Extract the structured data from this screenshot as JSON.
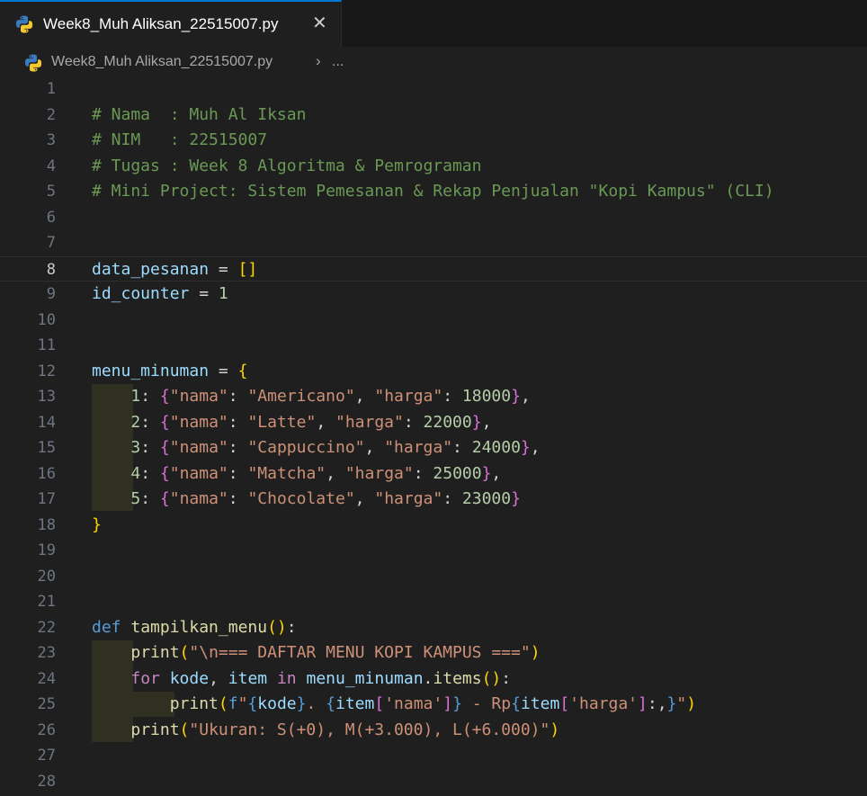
{
  "tab": {
    "title": "Week8_Muh Aliksan_22515007.py",
    "close": "✕"
  },
  "breadcrumb": {
    "file": "Week8_Muh Aliksan_22515007.py",
    "sep": "›",
    "more": "..."
  },
  "current_line": 8,
  "lines": [
    [],
    [
      [
        "c",
        "# Nama  : Muh Al Iksan"
      ]
    ],
    [
      [
        "c",
        "# NIM   : 22515007"
      ]
    ],
    [
      [
        "c",
        "# Tugas : Week 8 Algoritma & Pemrograman"
      ]
    ],
    [
      [
        "c",
        "# Mini Project: Sistem Pemesanan & Rekap Penjualan \"Kopi Kampus\" (CLI)"
      ]
    ],
    [],
    [],
    [
      [
        "v",
        "data_pesanan"
      ],
      [
        "op",
        " = "
      ],
      [
        "b1",
        "[]"
      ]
    ],
    [
      [
        "v",
        "id_counter"
      ],
      [
        "op",
        " = "
      ],
      [
        "n",
        "1"
      ]
    ],
    [],
    [],
    [
      [
        "v",
        "menu_minuman"
      ],
      [
        "op",
        " = "
      ],
      [
        "b1",
        "{"
      ]
    ],
    [
      [
        "op",
        "    "
      ],
      [
        "n",
        "1"
      ],
      [
        "op",
        ": "
      ],
      [
        "b2",
        "{"
      ],
      [
        "s",
        "\"nama\""
      ],
      [
        "op",
        ": "
      ],
      [
        "s",
        "\"Americano\""
      ],
      [
        "op",
        ", "
      ],
      [
        "s",
        "\"harga\""
      ],
      [
        "op",
        ": "
      ],
      [
        "n",
        "18000"
      ],
      [
        "b2",
        "}"
      ],
      [
        "op",
        ","
      ]
    ],
    [
      [
        "op",
        "    "
      ],
      [
        "n",
        "2"
      ],
      [
        "op",
        ": "
      ],
      [
        "b2",
        "{"
      ],
      [
        "s",
        "\"nama\""
      ],
      [
        "op",
        ": "
      ],
      [
        "s",
        "\"Latte\""
      ],
      [
        "op",
        ", "
      ],
      [
        "s",
        "\"harga\""
      ],
      [
        "op",
        ": "
      ],
      [
        "n",
        "22000"
      ],
      [
        "b2",
        "}"
      ],
      [
        "op",
        ","
      ]
    ],
    [
      [
        "op",
        "    "
      ],
      [
        "n",
        "3"
      ],
      [
        "op",
        ": "
      ],
      [
        "b2",
        "{"
      ],
      [
        "s",
        "\"nama\""
      ],
      [
        "op",
        ": "
      ],
      [
        "s",
        "\"Cappuccino\""
      ],
      [
        "op",
        ", "
      ],
      [
        "s",
        "\"harga\""
      ],
      [
        "op",
        ": "
      ],
      [
        "n",
        "24000"
      ],
      [
        "b2",
        "}"
      ],
      [
        "op",
        ","
      ]
    ],
    [
      [
        "op",
        "    "
      ],
      [
        "n",
        "4"
      ],
      [
        "op",
        ": "
      ],
      [
        "b2",
        "{"
      ],
      [
        "s",
        "\"nama\""
      ],
      [
        "op",
        ": "
      ],
      [
        "s",
        "\"Matcha\""
      ],
      [
        "op",
        ", "
      ],
      [
        "s",
        "\"harga\""
      ],
      [
        "op",
        ": "
      ],
      [
        "n",
        "25000"
      ],
      [
        "b2",
        "}"
      ],
      [
        "op",
        ","
      ]
    ],
    [
      [
        "op",
        "    "
      ],
      [
        "n",
        "5"
      ],
      [
        "op",
        ": "
      ],
      [
        "b2",
        "{"
      ],
      [
        "s",
        "\"nama\""
      ],
      [
        "op",
        ": "
      ],
      [
        "s",
        "\"Chocolate\""
      ],
      [
        "op",
        ", "
      ],
      [
        "s",
        "\"harga\""
      ],
      [
        "op",
        ": "
      ],
      [
        "n",
        "23000"
      ],
      [
        "b2",
        "}"
      ]
    ],
    [
      [
        "b1",
        "}"
      ]
    ],
    [],
    [],
    [],
    [
      [
        "k",
        "def"
      ],
      [
        "op",
        " "
      ],
      [
        "f",
        "tampilkan_menu"
      ],
      [
        "b1",
        "()"
      ],
      [
        "op",
        ":"
      ]
    ],
    [
      [
        "op",
        "    "
      ],
      [
        "f",
        "print"
      ],
      [
        "b1",
        "("
      ],
      [
        "s",
        "\"\\n=== DAFTAR MENU KOPI KAMPUS ===\""
      ],
      [
        "b1",
        ")"
      ]
    ],
    [
      [
        "op",
        "    "
      ],
      [
        "kc",
        "for"
      ],
      [
        "op",
        " "
      ],
      [
        "v",
        "kode"
      ],
      [
        "op",
        ", "
      ],
      [
        "v",
        "item"
      ],
      [
        "op",
        " "
      ],
      [
        "kc",
        "in"
      ],
      [
        "op",
        " "
      ],
      [
        "v",
        "menu_minuman"
      ],
      [
        "op",
        "."
      ],
      [
        "f",
        "items"
      ],
      [
        "b1",
        "()"
      ],
      [
        "op",
        ":"
      ]
    ],
    [
      [
        "op",
        "        "
      ],
      [
        "f",
        "print"
      ],
      [
        "b1",
        "("
      ],
      [
        "k",
        "f"
      ],
      [
        "s",
        "\""
      ],
      [
        "k",
        "{"
      ],
      [
        "v",
        "kode"
      ],
      [
        "k",
        "}"
      ],
      [
        "s",
        ". "
      ],
      [
        "k",
        "{"
      ],
      [
        "v",
        "item"
      ],
      [
        "b2",
        "["
      ],
      [
        "s",
        "'nama'"
      ],
      [
        "b2",
        "]"
      ],
      [
        "k",
        "}"
      ],
      [
        "s",
        " - Rp"
      ],
      [
        "k",
        "{"
      ],
      [
        "v",
        "item"
      ],
      [
        "b2",
        "["
      ],
      [
        "s",
        "'harga'"
      ],
      [
        "b2",
        "]"
      ],
      [
        "op",
        ":,"
      ],
      [
        "k",
        "}"
      ],
      [
        "s",
        "\""
      ],
      [
        "b1",
        ")"
      ]
    ],
    [
      [
        "op",
        "    "
      ],
      [
        "f",
        "print"
      ],
      [
        "b1",
        "("
      ],
      [
        "s",
        "\"Ukuran: S(+0), M(+3.000), L(+6.000)\""
      ],
      [
        "b1",
        ")"
      ]
    ],
    [],
    []
  ]
}
